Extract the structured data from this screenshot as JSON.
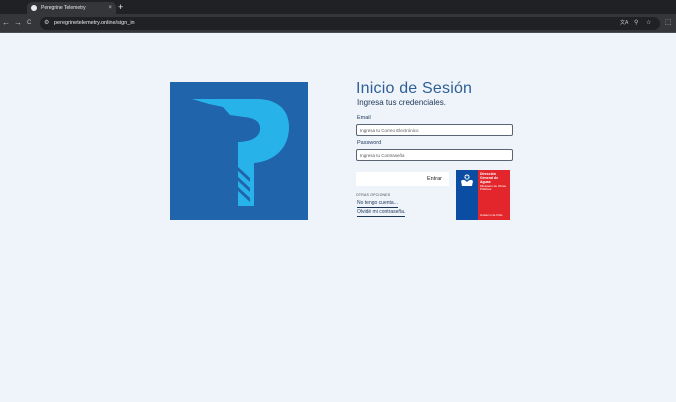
{
  "browser": {
    "tab_title": "Peregrine Telemetry",
    "tab_close": "×",
    "new_tab": "+",
    "back": "←",
    "forward": "→",
    "reload": "C",
    "url": "peregrinetelemetry.online/sign_in",
    "site_info_icon": "⚙",
    "translate_icon": "文A",
    "zoom_icon": "⚲",
    "bookmark_icon": "☆",
    "extensions_icon": "⬚"
  },
  "login": {
    "title": "Inicio de Sesión",
    "subtitle": "Ingresa tus credenciales.",
    "email_label": "Email",
    "email_placeholder": "Ingresa tu Correo Electrónico",
    "password_label": "Password",
    "password_placeholder": "Ingresa tu Contraseña",
    "submit_label": "Entrar",
    "options_heading": "OTRAS OPCIONES",
    "no_account_link": "No tengo cuenta...",
    "forgot_password_link": "Olvidé mi contraseña."
  },
  "dga_logo": {
    "title": "Dirección General de Aguas",
    "ministry": "Ministerio de Obras Públicas",
    "government": "Gobierno de Chile"
  },
  "colors": {
    "page_background": "#eff4fb",
    "brand_blue": "#2065ab",
    "logo_mark": "#27b3ea",
    "title_blue": "#2e5f96",
    "dga_blue": "#0b4da2",
    "dga_red": "#e2262b"
  }
}
